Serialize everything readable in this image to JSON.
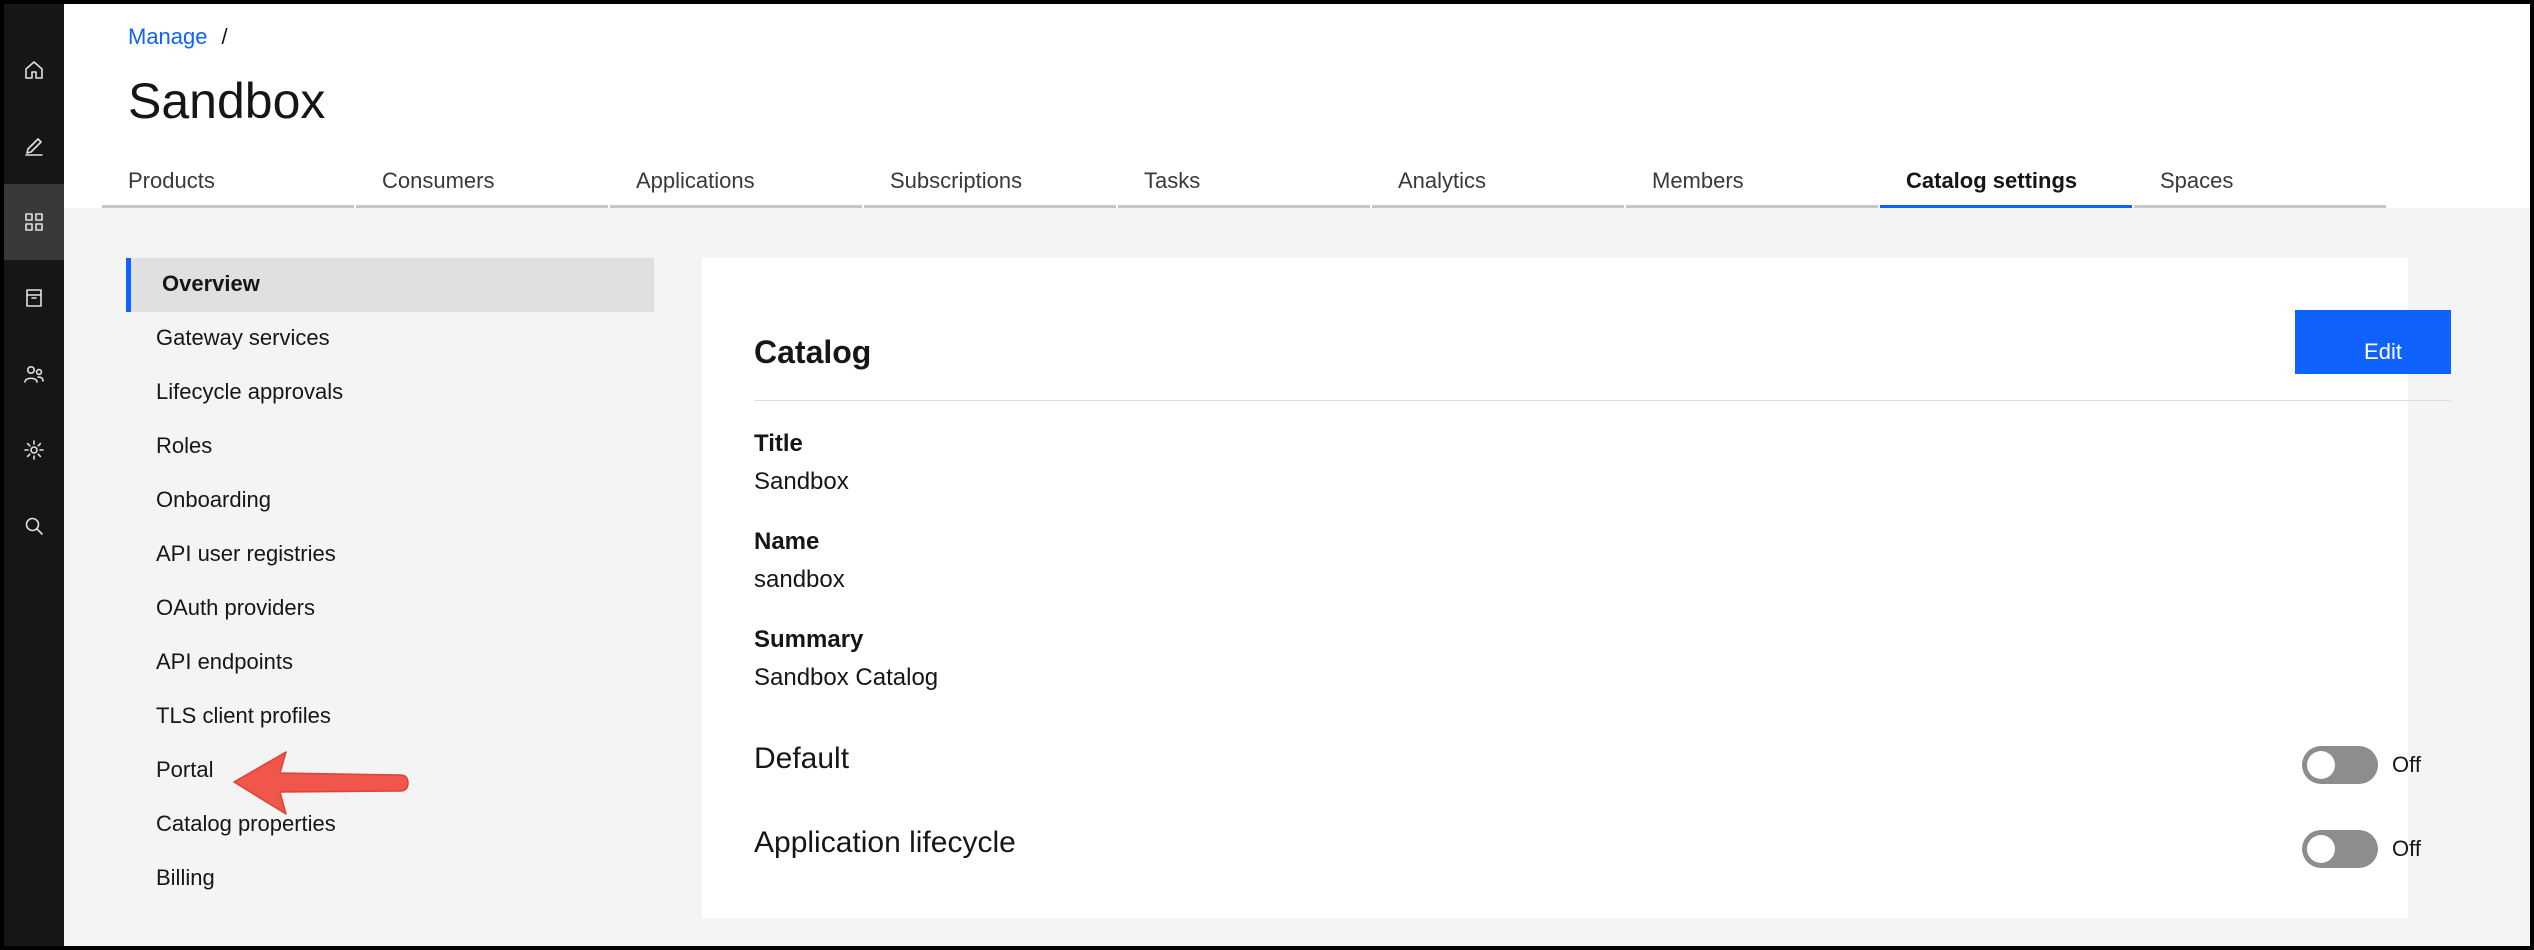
{
  "rail": {
    "items": [
      {
        "icon": "home-icon",
        "active": false
      },
      {
        "icon": "edit-icon",
        "active": false
      },
      {
        "icon": "grid-icon",
        "active": true
      },
      {
        "icon": "archive-icon",
        "active": false
      },
      {
        "icon": "users-icon",
        "active": false
      },
      {
        "icon": "settings-icon",
        "active": false
      },
      {
        "icon": "search-icon",
        "active": false
      }
    ]
  },
  "header": {
    "breadcrumb": {
      "link": "Manage",
      "separator": "/"
    },
    "title": "Sandbox",
    "tabs": [
      {
        "label": "Products"
      },
      {
        "label": "Consumers"
      },
      {
        "label": "Applications"
      },
      {
        "label": "Subscriptions"
      },
      {
        "label": "Tasks"
      },
      {
        "label": "Analytics"
      },
      {
        "label": "Members"
      },
      {
        "label": "Catalog settings"
      },
      {
        "label": "Spaces"
      }
    ],
    "selected_tab": "Catalog settings"
  },
  "side_nav": {
    "items": [
      {
        "label": "Overview"
      },
      {
        "label": "Gateway services"
      },
      {
        "label": "Lifecycle approvals"
      },
      {
        "label": "Roles"
      },
      {
        "label": "Onboarding"
      },
      {
        "label": "API user registries"
      },
      {
        "label": "OAuth providers"
      },
      {
        "label": "API endpoints"
      },
      {
        "label": "TLS client profiles"
      },
      {
        "label": "Portal"
      },
      {
        "label": "Catalog properties"
      },
      {
        "label": "Billing"
      }
    ],
    "selected": "Overview"
  },
  "card": {
    "title": "Catalog",
    "edit_label": "Edit",
    "fields": {
      "title_label": "Title",
      "title_value": "Sandbox",
      "name_label": "Name",
      "name_value": "sandbox",
      "summary_label": "Summary",
      "summary_value": "Sandbox Catalog"
    },
    "toggles": {
      "default_label": "Default",
      "default_state": "Off",
      "lifecycle_label": "Application lifecycle",
      "lifecycle_state": "Off"
    }
  },
  "colors": {
    "accent": "#0f62fe",
    "rail_bg": "#161616",
    "annotation_arrow": "#f0564a"
  }
}
